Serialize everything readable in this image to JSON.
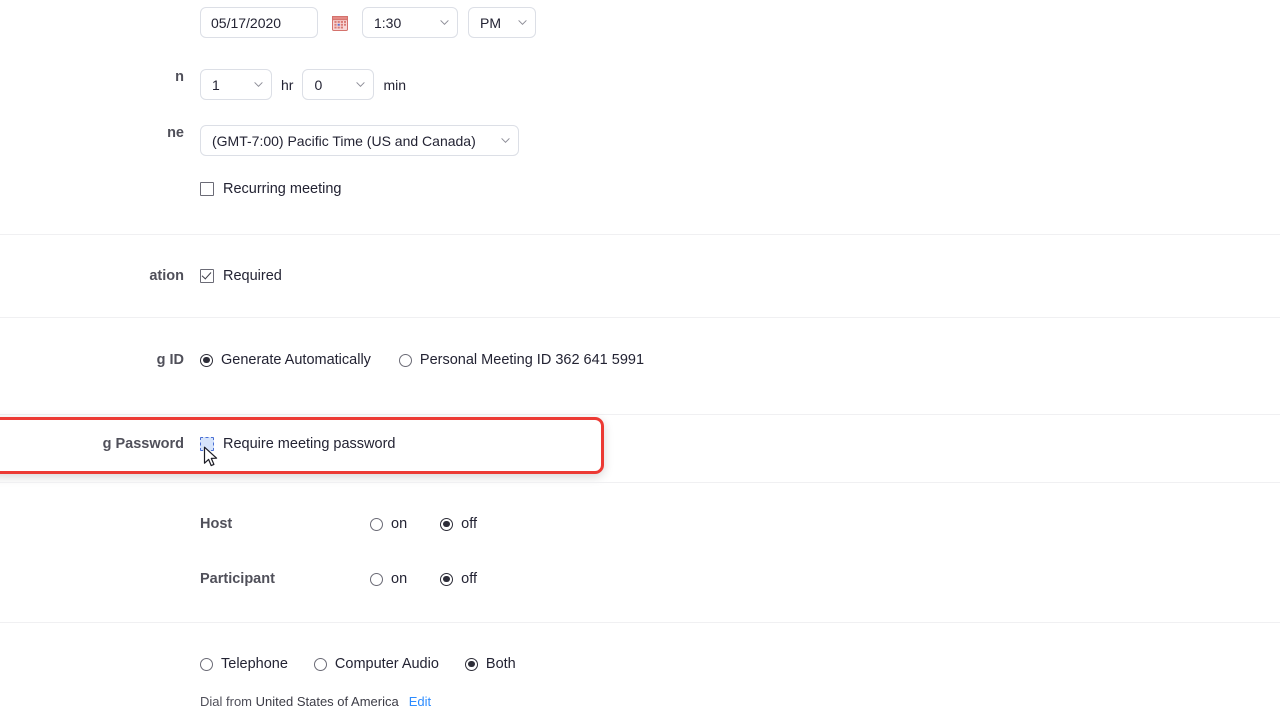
{
  "meta": {
    "app": "zoom-schedule-meeting",
    "accent_red": "#ec3a34",
    "link_blue": "#2d8cff",
    "label_gray": "#50505a",
    "divider_gray": "#f0f0f2",
    "border_gray": "#dcdfe6"
  },
  "rows": {
    "when": {
      "date_value": "05/17/2020",
      "calendar_icon": "calendar-icon",
      "time_value": "1:30",
      "meridiem_value": "PM"
    },
    "duration": {
      "label": "n",
      "hours_value": "1",
      "hours_unit": "hr",
      "minutes_value": "0",
      "minutes_unit": "min"
    },
    "timezone": {
      "label": "ne",
      "value": "(GMT-7:00) Pacific Time (US and Canada)",
      "recurring_label": "Recurring meeting",
      "recurring_checked": false
    },
    "registration": {
      "label": "ation",
      "required_label": "Required",
      "required_checked": true
    },
    "meeting_id": {
      "label": "g ID",
      "options": [
        {
          "label": "Generate Automatically",
          "selected": true
        },
        {
          "label": "Personal Meeting ID 362 641 5991",
          "selected": false
        }
      ]
    },
    "meeting_password": {
      "label": "g Password",
      "checkbox_label": "Require meeting password",
      "checked": false,
      "focused": true,
      "highlighted": true
    },
    "video": {
      "host": {
        "label": "Host",
        "options": [
          {
            "label": "on",
            "selected": false
          },
          {
            "label": "off",
            "selected": true
          }
        ]
      },
      "participant": {
        "label": "Participant",
        "options": [
          {
            "label": "on",
            "selected": false
          },
          {
            "label": "off",
            "selected": true
          }
        ]
      }
    },
    "audio": {
      "options": [
        {
          "label": "Telephone",
          "selected": false
        },
        {
          "label": "Computer Audio",
          "selected": false
        },
        {
          "label": "Both",
          "selected": true
        }
      ],
      "dial_prefix": "Dial from ",
      "dial_country": "United States of America",
      "edit_link": "Edit"
    }
  }
}
